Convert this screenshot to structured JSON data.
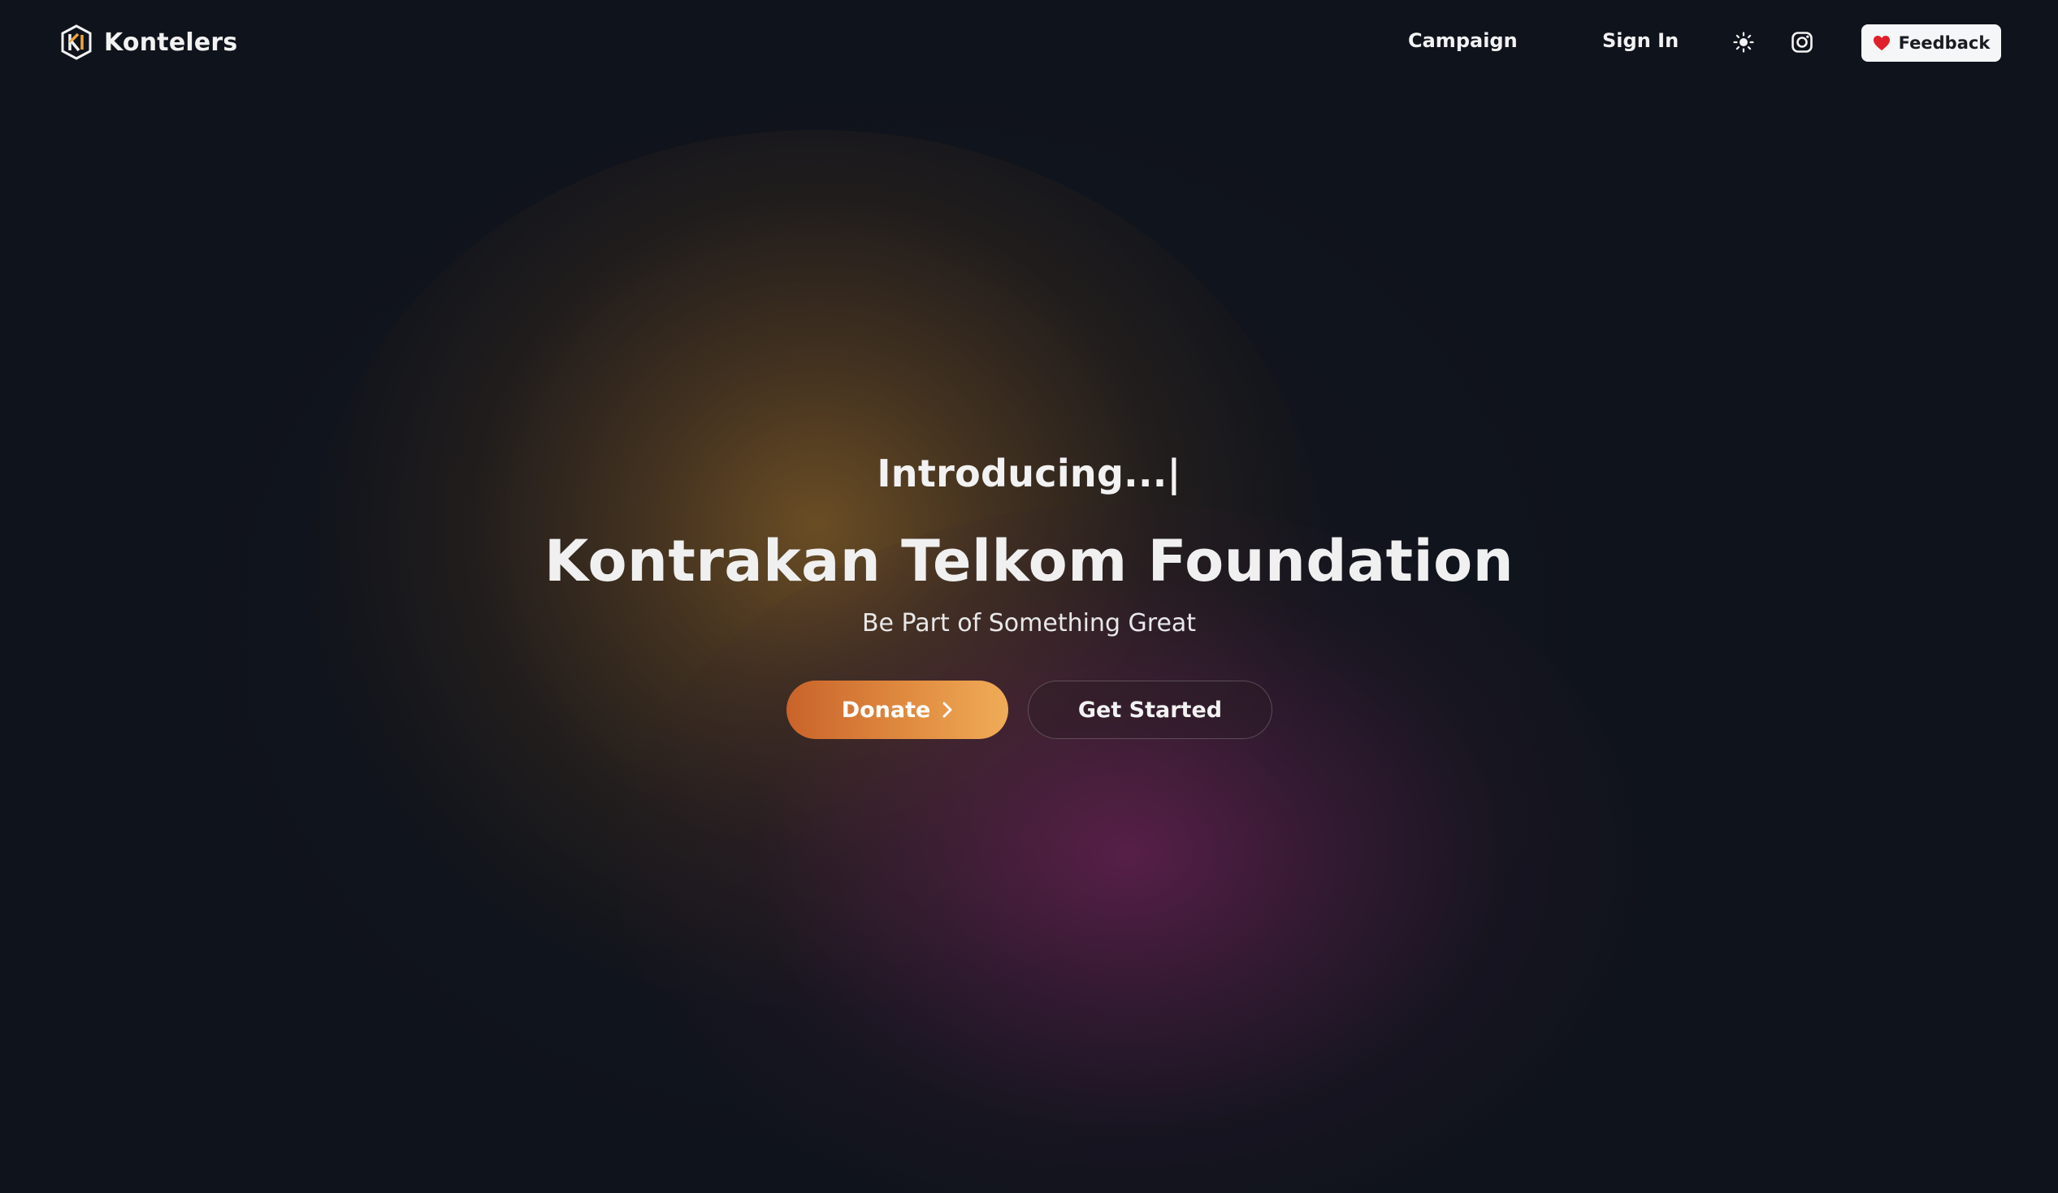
{
  "brand": {
    "name": "Kontelers",
    "logo_icon": "kontelers-logo-icon",
    "logo_colors": [
      "#f2f2f2",
      "#f0a43c"
    ]
  },
  "nav": {
    "links": [
      {
        "label": "Campaign"
      },
      {
        "label": "Sign In"
      }
    ],
    "icons": [
      "sun-icon",
      "instagram-icon"
    ],
    "feedback": {
      "label": "Feedback",
      "icon": "heart-icon",
      "icon_color": "#e0202a"
    }
  },
  "hero": {
    "intro": "Introducing...|",
    "title": "Kontrakan Telkom Foundation",
    "subtitle": "Be Part of Something Great",
    "buttons": {
      "donate": {
        "label": "Donate",
        "icon": "chevron-right-icon"
      },
      "get_started": {
        "label": "Get Started"
      }
    }
  },
  "colors": {
    "background": "#0f131c",
    "accent_gradient_start": "#c9632a",
    "accent_gradient_end": "#f0ac58",
    "glow_orange": "#825c26",
    "glow_magenta": "#702258"
  }
}
